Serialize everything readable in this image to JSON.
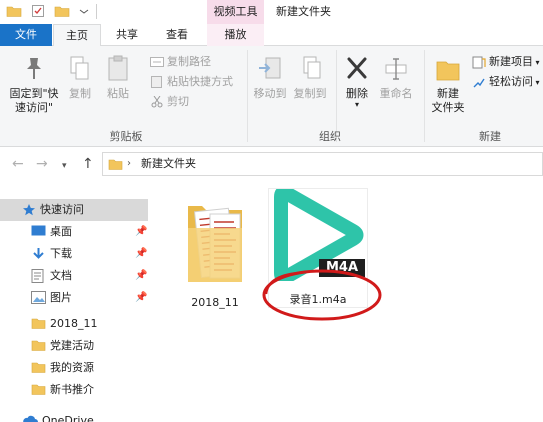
{
  "window": {
    "title": "新建文件夹",
    "context_tab_header": "视频工具"
  },
  "tabs": {
    "file": "文件",
    "home": "主页",
    "share": "共享",
    "view": "查看",
    "play": "播放"
  },
  "ribbon": {
    "clipboard": {
      "pin_label_1": "固定到\"快",
      "pin_label_2": "速访问\"",
      "copy": "复制",
      "paste": "粘贴",
      "copy_path": "复制路径",
      "paste_shortcut": "粘贴快捷方式",
      "cut": "剪切",
      "group": "剪贴板"
    },
    "organize": {
      "move_to": "移动到",
      "copy_to": "复制到",
      "delete": "删除",
      "rename": "重命名",
      "group": "组织"
    },
    "new": {
      "new_folder_1": "新建",
      "new_folder_2": "文件夹",
      "new_item": "新建项目",
      "easy_access": "轻松访问",
      "group": "新建"
    }
  },
  "address": {
    "path": "新建文件夹"
  },
  "nav": {
    "quick_access": "快速访问",
    "items": [
      {
        "label": "桌面"
      },
      {
        "label": "下载"
      },
      {
        "label": "文档"
      },
      {
        "label": "图片"
      },
      {
        "label": "2018_11"
      },
      {
        "label": "党建活动"
      },
      {
        "label": "我的资源"
      },
      {
        "label": "新书推介"
      }
    ],
    "onedrive": "OneDrive"
  },
  "files": [
    {
      "name": "2018_11"
    },
    {
      "name": "录音1.m4a",
      "badge": "M4A"
    }
  ],
  "colors": {
    "accent": "#1a73c8",
    "context_tab": "#f7dcea",
    "play_icon": "#2ec4a9",
    "annotation": "#d11a1a"
  }
}
